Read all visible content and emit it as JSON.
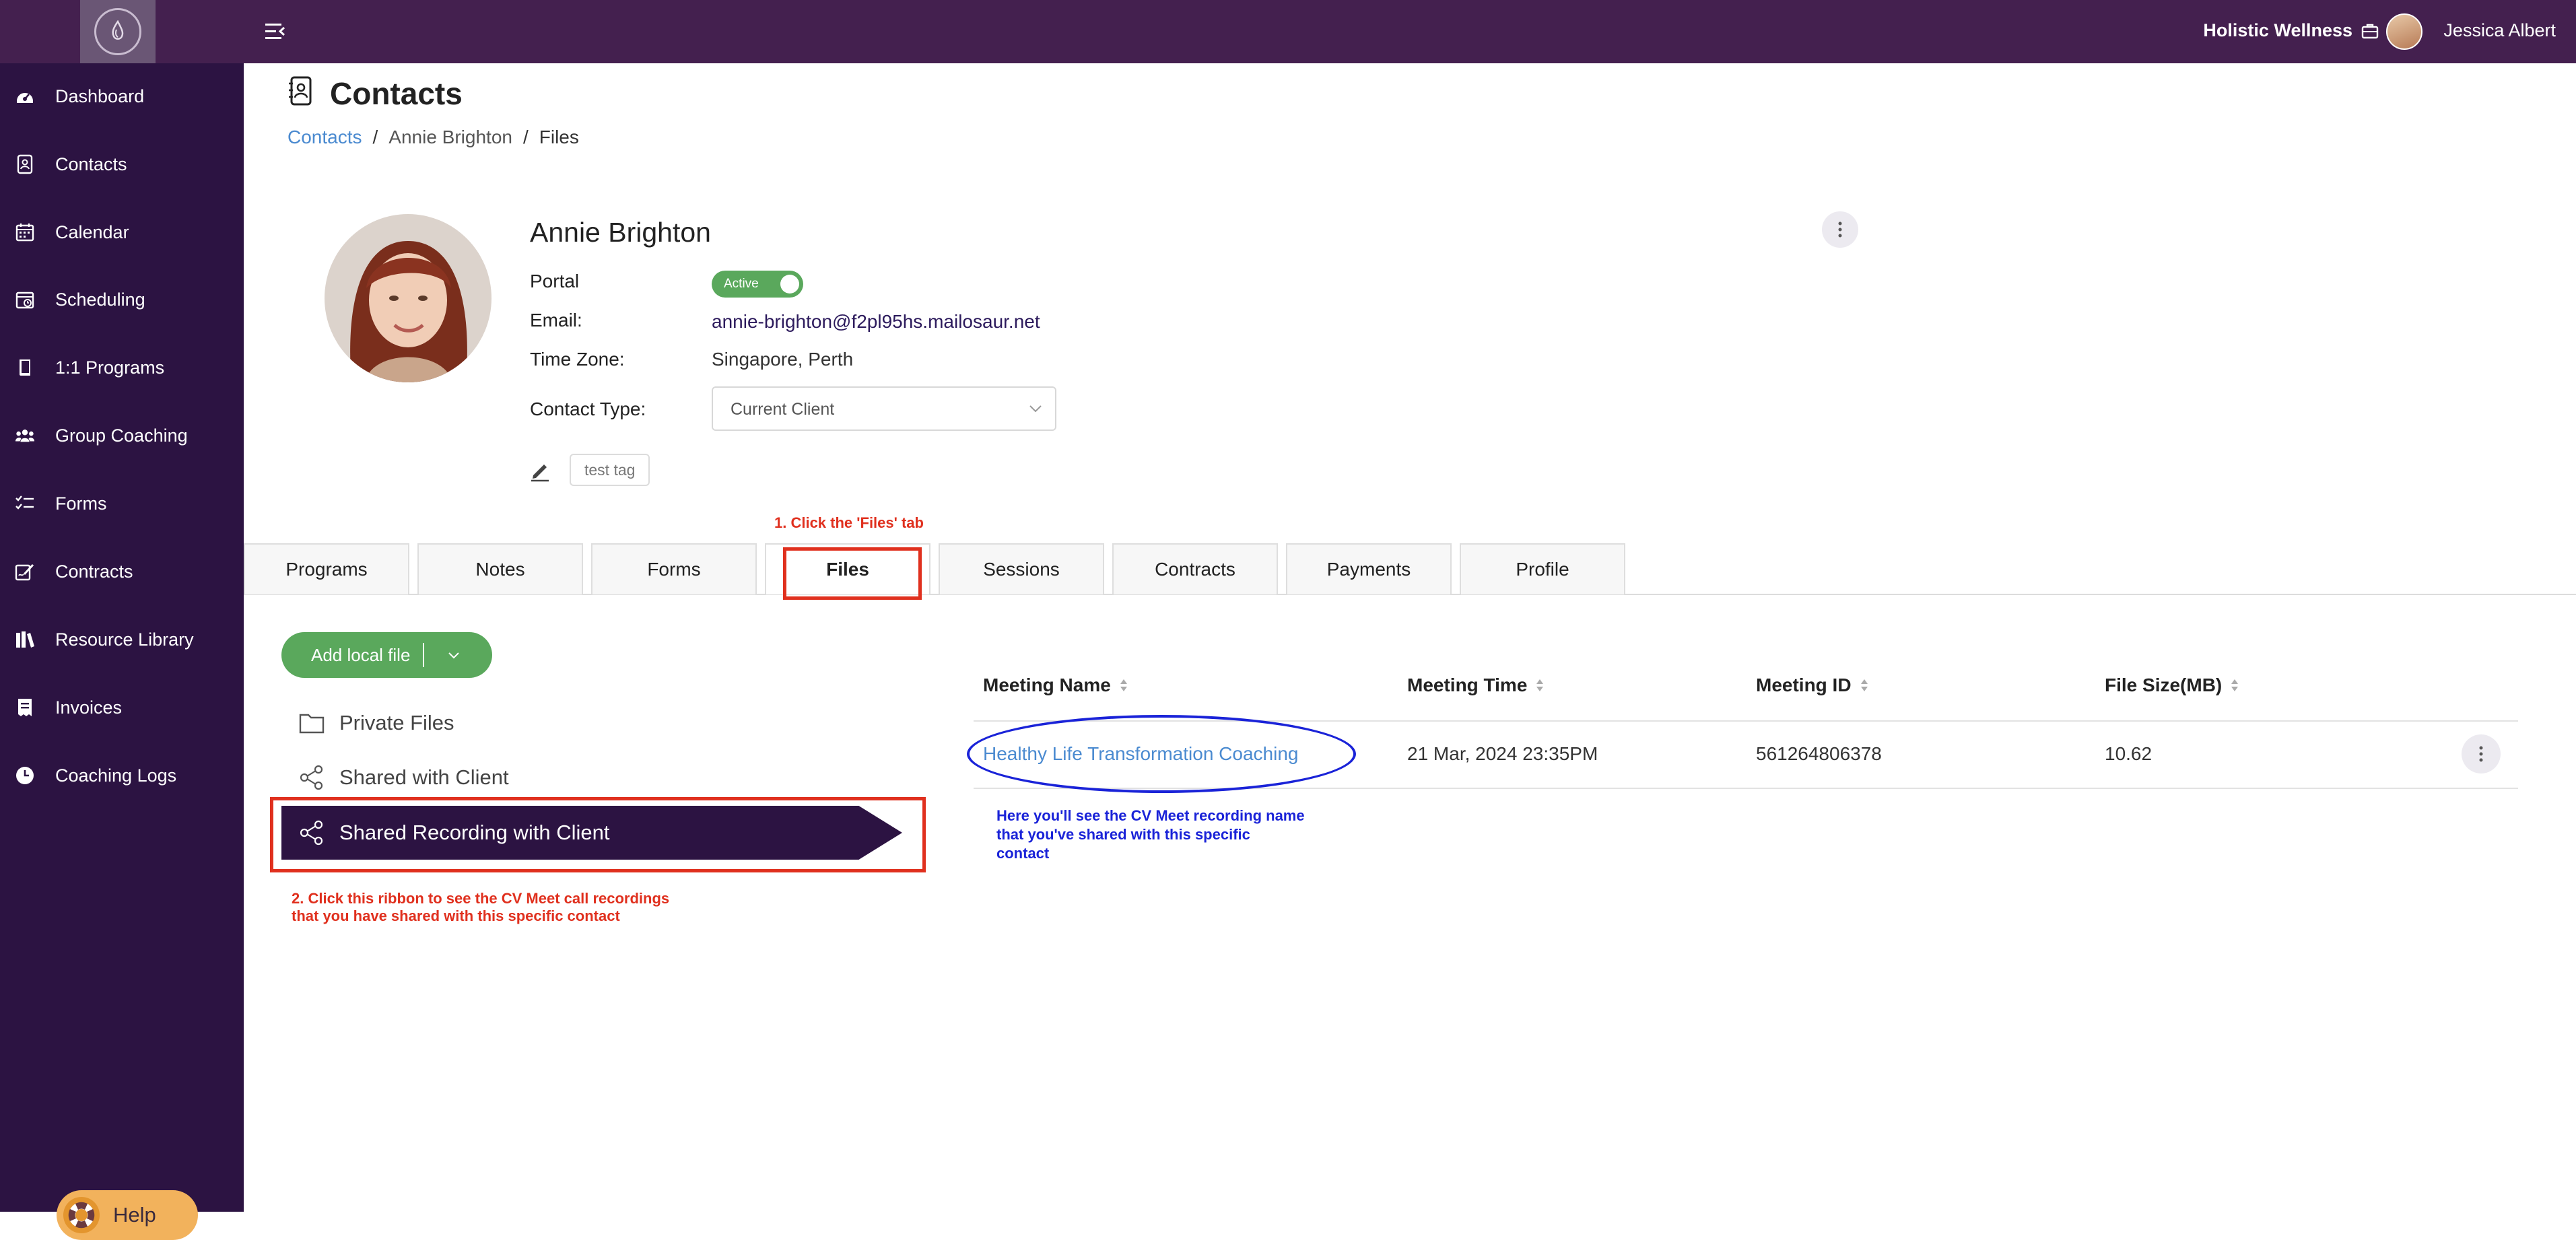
{
  "topbar": {
    "brand": "Holistic Wellness",
    "user_name": "Jessica Albert"
  },
  "sidebar": {
    "items": [
      {
        "label": "Dashboard",
        "icon": "dashboard-icon"
      },
      {
        "label": "Contacts",
        "icon": "contacts-icon"
      },
      {
        "label": "Calendar",
        "icon": "calendar-icon"
      },
      {
        "label": "Scheduling",
        "icon": "scheduling-icon"
      },
      {
        "label": "1:1 Programs",
        "icon": "book-icon"
      },
      {
        "label": "Group Coaching",
        "icon": "group-icon"
      },
      {
        "label": "Forms",
        "icon": "forms-icon"
      },
      {
        "label": "Contracts",
        "icon": "contract-icon"
      },
      {
        "label": "Resource Library",
        "icon": "library-icon"
      },
      {
        "label": "Invoices",
        "icon": "invoice-icon"
      },
      {
        "label": "Coaching Logs",
        "icon": "clock-icon"
      }
    ],
    "help_label": "Help"
  },
  "header": {
    "title": "Contacts",
    "breadcrumb": [
      "Contacts",
      "Annie Brighton",
      "Files"
    ]
  },
  "profile": {
    "name": "Annie Brighton",
    "portal_label": "Portal",
    "portal_status": "Active",
    "email_label": "Email:",
    "email": "annie-brighton@f2pl95hs.mailosaur.net",
    "timezone_label": "Time Zone:",
    "timezone": "Singapore, Perth",
    "contact_type_label": "Contact Type:",
    "contact_type": "Current Client",
    "tag": "test tag"
  },
  "annotations": {
    "tab_hint": "1. Click the 'Files' tab",
    "ribbon_hint_1": "2. Click this ribbon to see the CV Meet call recordings",
    "ribbon_hint_2": "that you have shared with this specific contact",
    "table_hint_1": "Here you'll see the CV Meet recording name",
    "table_hint_2": "that you've shared with this specific",
    "table_hint_3": "contact"
  },
  "tabs": [
    "Programs",
    "Notes",
    "Forms",
    "Files",
    "Sessions",
    "Contracts",
    "Payments",
    "Profile"
  ],
  "active_tab": "Files",
  "files": {
    "add_button": "Add local file",
    "folders": [
      "Private Files",
      "Shared with Client",
      "Shared Recording with Client"
    ],
    "selected_folder": "Shared Recording with Client"
  },
  "table": {
    "columns": [
      "Meeting Name",
      "Meeting Time",
      "Meeting ID",
      "File Size(MB)"
    ],
    "rows": [
      [
        "Healthy Life Transformation Coaching",
        "21 Mar, 2024 23:35PM",
        "561264806378",
        "10.62"
      ]
    ]
  },
  "colors": {
    "topbar": "#44204f",
    "sidebar": "#2c1342",
    "accent_green": "#5aa85c",
    "link_blue": "#4a8ad0",
    "annotation_red": "#e0301e",
    "annotation_blue": "#1a23d8",
    "help_orange": "#f2b25c"
  }
}
